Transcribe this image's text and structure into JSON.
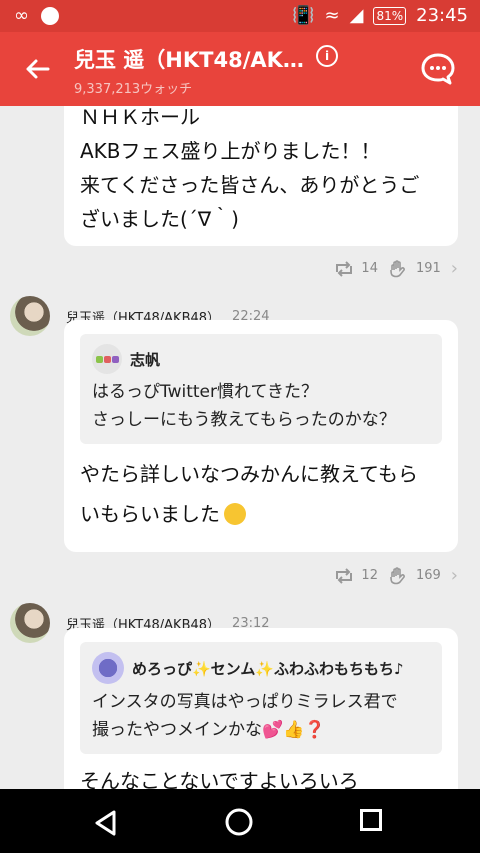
{
  "statusbar": {
    "battery": "81%",
    "time": "23:45"
  },
  "header": {
    "back_icon": "arrow-left-icon",
    "title": "兒玉 遥（HKT48/AKB…",
    "info_icon": "info-icon",
    "watch_count": "9,337,213ウォッチ",
    "chat_icon": "chat-bubble-icon"
  },
  "posts": [
    {
      "text": "ＮＨＫホール\nAKBフェス盛り上がりました！！\n来てくださった皆さん、ありがとうご\nざいました(´∇｀)",
      "retweets": "14",
      "likes": "191"
    },
    {
      "author": "兒玉遥（HKT48/AKB48）",
      "time": "22:24",
      "quote_name": "志帆",
      "quote_text": "はるっぴTwitter慣れてきた？\nさっしーにもう教えてもらったのかな？",
      "text": "やたら詳しいなつみかんに教えてもら\nいもらいました",
      "retweets": "12",
      "likes": "169"
    },
    {
      "author": "兒玉遥（HKT48/AKB48）",
      "time": "23:12",
      "quote_name": "めろっぴ✨センム✨ふわふわもちもち♪",
      "quote_text": "インスタの写真はやっぱりミラレス君で\n撮ったやつメインかな💕👍❓",
      "text": "そんなことないですよいろいろ"
    }
  ],
  "colors": {
    "header": "#e8443c",
    "statusbar": "#d83c34",
    "background": "#ededed"
  }
}
